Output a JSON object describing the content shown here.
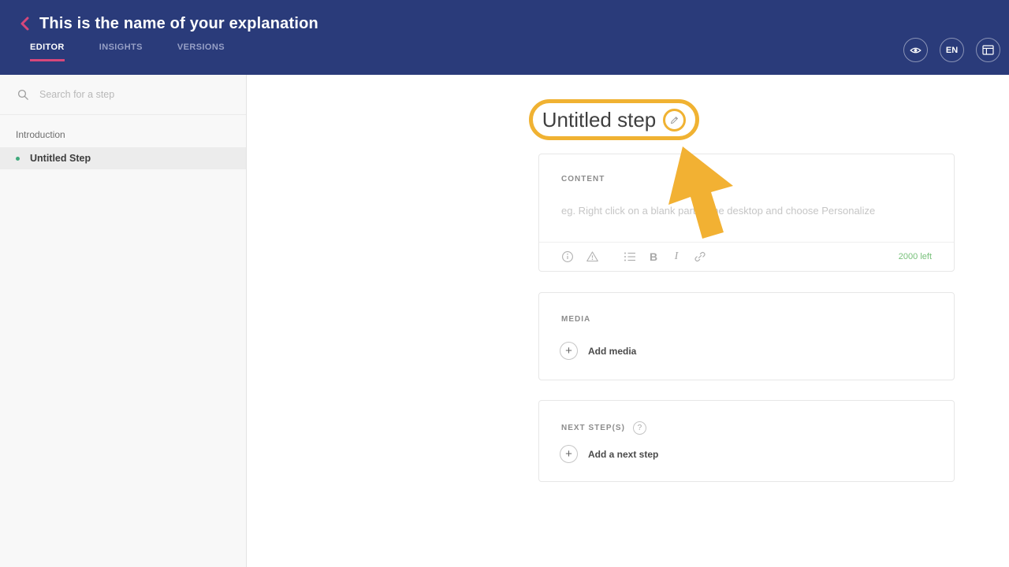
{
  "header": {
    "title": "This is the name of your explanation",
    "tabs": [
      {
        "label": "EDITOR",
        "active": true
      },
      {
        "label": "INSIGHTS",
        "active": false
      },
      {
        "label": "VERSIONS",
        "active": false
      }
    ],
    "actions": {
      "language": "EN"
    }
  },
  "sidebar": {
    "search_placeholder": "Search for a step",
    "section_label": "Introduction",
    "steps": [
      {
        "label": "Untitled Step",
        "selected": true
      }
    ]
  },
  "main": {
    "step_title": "Untitled step",
    "content_card": {
      "label": "CONTENT",
      "placeholder": "eg. Right click on a blank part of the desktop and choose Personalize",
      "chars_left": "2000 left"
    },
    "media_card": {
      "label": "MEDIA",
      "add_label": "Add media"
    },
    "next_card": {
      "label": "NEXT STEP(S)",
      "add_label": "Add a next step"
    }
  },
  "icons": {
    "plus_glyph": "+",
    "help_glyph": "?",
    "bold_glyph": "B",
    "italic_glyph": "I"
  },
  "colors": {
    "header_bg": "#2a3b7a",
    "accent_pink": "#d6477b",
    "highlight_yellow": "#f0b232",
    "cursor_yellow": "#f2b133",
    "step_dot_green": "#3fa97c",
    "chars_left_green": "#77c07a",
    "sidebar_bg": "#f8f8f8",
    "selected_row": "#ececec"
  }
}
